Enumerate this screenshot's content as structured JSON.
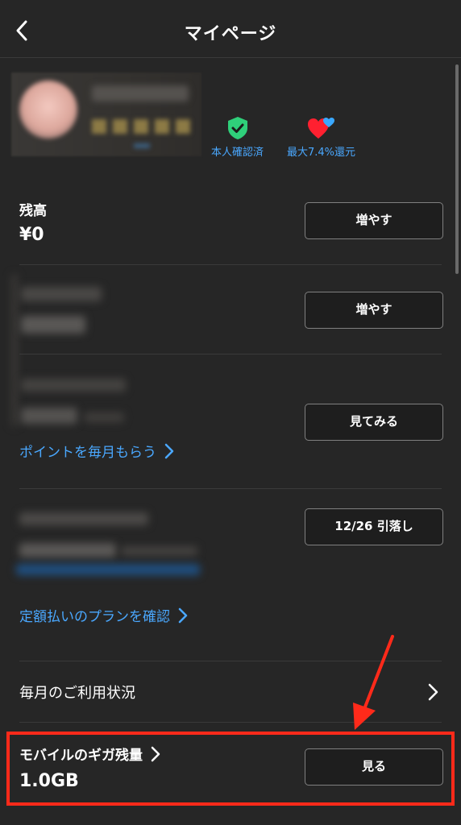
{
  "header": {
    "title": "マイページ"
  },
  "badges": {
    "verified": "本人確認済",
    "cashback": "最大7.4%還元"
  },
  "balance": {
    "label": "残高",
    "value": "¥0",
    "button": "増やす"
  },
  "points": {
    "button": "増やす"
  },
  "invest": {
    "button": "見てみる",
    "link": "ポイントを毎月もらう"
  },
  "payment": {
    "button": "12/26 引落し",
    "link": "定額払いのプランを確認"
  },
  "usage": {
    "label": "毎月のご利用状況"
  },
  "mobile": {
    "label": "モバイルのギガ残量",
    "value": "1.0GB",
    "button": "見る"
  },
  "colors": {
    "accent": "#4aa8ff",
    "highlight": "#ff2a1a",
    "background": "#262626"
  }
}
